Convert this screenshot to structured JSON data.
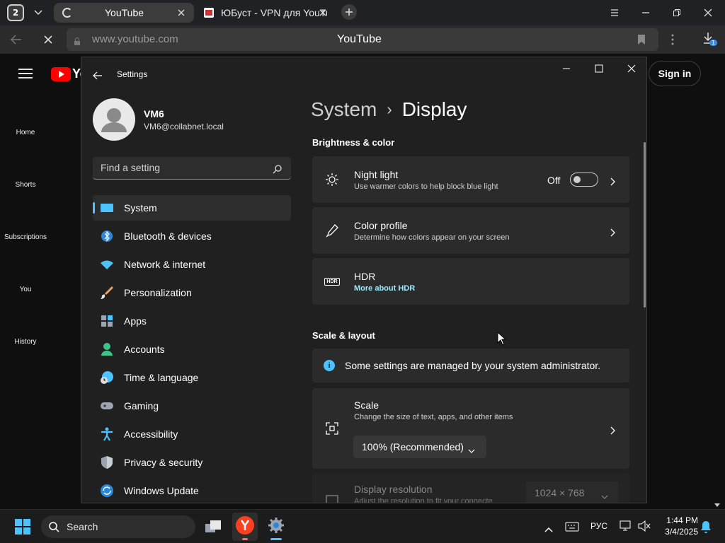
{
  "browser": {
    "tab_count": "2",
    "tabs": [
      {
        "title": "YouTube"
      },
      {
        "title": "ЮБуст - VPN для YouTube"
      }
    ],
    "url": "www.youtube.com",
    "page_title": "YouTube",
    "download_badge": "1"
  },
  "youtube": {
    "logo_text": "Yo",
    "nav": [
      "Home",
      "Shorts",
      "Subscriptions",
      "You",
      "History"
    ],
    "sign_in": "Sign in"
  },
  "settings": {
    "window_title": "Settings",
    "user": {
      "name": "VM6",
      "email": "VM6@collabnet.local"
    },
    "search_placeholder": "Find a setting",
    "nav": [
      {
        "label": "System",
        "icon": "system-icon",
        "color": "#4cc2ff"
      },
      {
        "label": "Bluetooth & devices",
        "icon": "bluetooth-icon",
        "color": "#2b88d8"
      },
      {
        "label": "Network & internet",
        "icon": "wifi-icon",
        "color": "#4cc2ff"
      },
      {
        "label": "Personalization",
        "icon": "brush-icon",
        "color": "#e8a06a"
      },
      {
        "label": "Apps",
        "icon": "apps-icon",
        "color": "#9aa5b1"
      },
      {
        "label": "Accounts",
        "icon": "accounts-icon",
        "color": "#3ec48a"
      },
      {
        "label": "Time & language",
        "icon": "globe-clock-icon",
        "color": "#4cc2ff"
      },
      {
        "label": "Gaming",
        "icon": "gamepad-icon",
        "color": "#9aa5b1"
      },
      {
        "label": "Accessibility",
        "icon": "accessibility-icon",
        "color": "#4cc2ff"
      },
      {
        "label": "Privacy & security",
        "icon": "shield-icon",
        "color": "#9aa5b1"
      },
      {
        "label": "Windows Update",
        "icon": "update-icon",
        "color": "#4cc2ff"
      }
    ],
    "breadcrumb": {
      "parent": "System",
      "separator": "›",
      "current": "Display"
    },
    "brightness_section": "Brightness & color",
    "night_light": {
      "title": "Night light",
      "subtitle": "Use warmer colors to help block blue light",
      "state": "Off"
    },
    "color_profile": {
      "title": "Color profile",
      "subtitle": "Determine how colors appear on your screen"
    },
    "hdr": {
      "title": "HDR",
      "link": "More about HDR",
      "badge": "HDR"
    },
    "scale_section": "Scale & layout",
    "admin_notice": "Some settings are managed by your system administrator.",
    "scale": {
      "title": "Scale",
      "subtitle": "Change the size of text, apps, and other items",
      "value": "100% (Recommended)"
    },
    "display_resolution": {
      "title": "Display resolution",
      "subtitle": "Adjust the resolution to fit your connecte",
      "value": "1024 × 768"
    }
  },
  "taskbar": {
    "search": "Search",
    "language": "РУС",
    "time": "1:44 PM",
    "date": "3/4/2025"
  },
  "colors": {
    "accent": "#4cc2ff",
    "link": "#99ebff",
    "youtube_red": "#ff0000"
  }
}
